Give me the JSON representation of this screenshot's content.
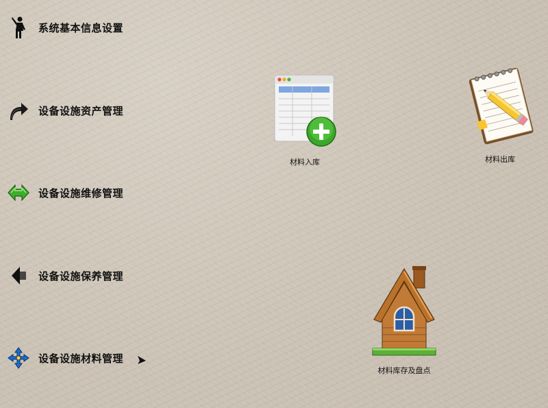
{
  "sidebar": {
    "items": [
      {
        "label": "系统基本信息设置",
        "icon": "person-waving-icon"
      },
      {
        "label": "设备设施资产管理",
        "icon": "curved-arrow-icon"
      },
      {
        "label": "设备设施维修管理",
        "icon": "double-arrow-icon"
      },
      {
        "label": "设备设施保养管理",
        "icon": "left-arrow-icon"
      },
      {
        "label": "设备设施材料管理",
        "icon": "compass-arrows-icon"
      }
    ],
    "expanded_item_indicator": "submenu-arrow-icon"
  },
  "tiles": [
    {
      "label": "材料入库",
      "icon": "table-add-icon"
    },
    {
      "label": "材料出库",
      "icon": "notepad-pencil-icon"
    },
    {
      "label": "材料库存及盘点",
      "icon": "house-icon"
    }
  ],
  "colors": {
    "background": "#cfc6b9",
    "text": "#111111",
    "accent_green": "#3cae2c",
    "accent_blue": "#1a6fd0"
  }
}
